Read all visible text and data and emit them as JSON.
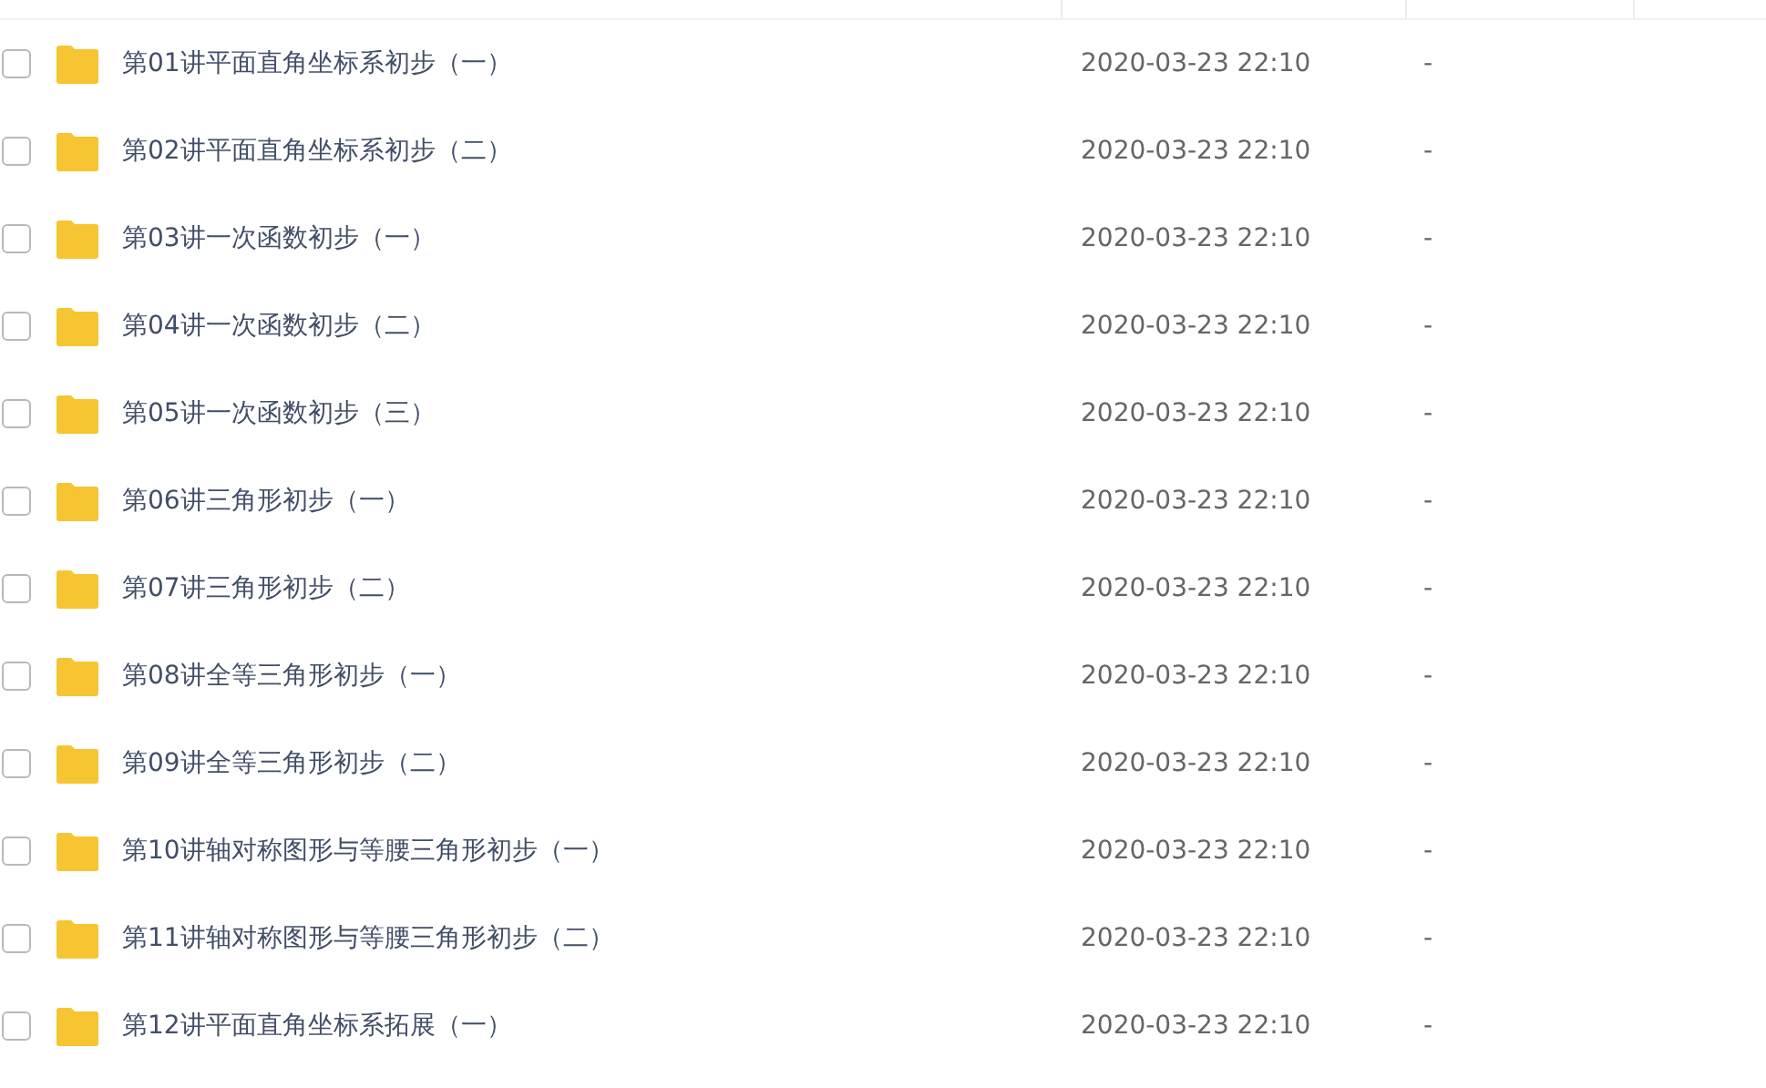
{
  "files": [
    {
      "name": "第01讲平面直角坐标系初步（一）",
      "modified": "2020-03-23 22:10",
      "size": "-",
      "checked": false
    },
    {
      "name": "第02讲平面直角坐标系初步（二）",
      "modified": "2020-03-23 22:10",
      "size": "-",
      "checked": false
    },
    {
      "name": "第03讲一次函数初步（一）",
      "modified": "2020-03-23 22:10",
      "size": "-",
      "checked": false
    },
    {
      "name": "第04讲一次函数初步（二）",
      "modified": "2020-03-23 22:10",
      "size": "-",
      "checked": false
    },
    {
      "name": "第05讲一次函数初步（三）",
      "modified": "2020-03-23 22:10",
      "size": "-",
      "checked": false
    },
    {
      "name": "第06讲三角形初步（一）",
      "modified": "2020-03-23 22:10",
      "size": "-",
      "checked": false
    },
    {
      "name": "第07讲三角形初步（二）",
      "modified": "2020-03-23 22:10",
      "size": "-",
      "checked": false
    },
    {
      "name": "第08讲全等三角形初步（一）",
      "modified": "2020-03-23 22:10",
      "size": "-",
      "checked": false
    },
    {
      "name": "第09讲全等三角形初步（二）",
      "modified": "2020-03-23 22:10",
      "size": "-",
      "checked": false
    },
    {
      "name": "第10讲轴对称图形与等腰三角形初步（一）",
      "modified": "2020-03-23 22:10",
      "size": "-",
      "checked": false
    },
    {
      "name": "第11讲轴对称图形与等腰三角形初步（二）",
      "modified": "2020-03-23 22:10",
      "size": "-",
      "checked": false
    },
    {
      "name": "第12讲平面直角坐标系拓展（一）",
      "modified": "2020-03-23 22:10",
      "size": "-",
      "checked": false
    }
  ]
}
